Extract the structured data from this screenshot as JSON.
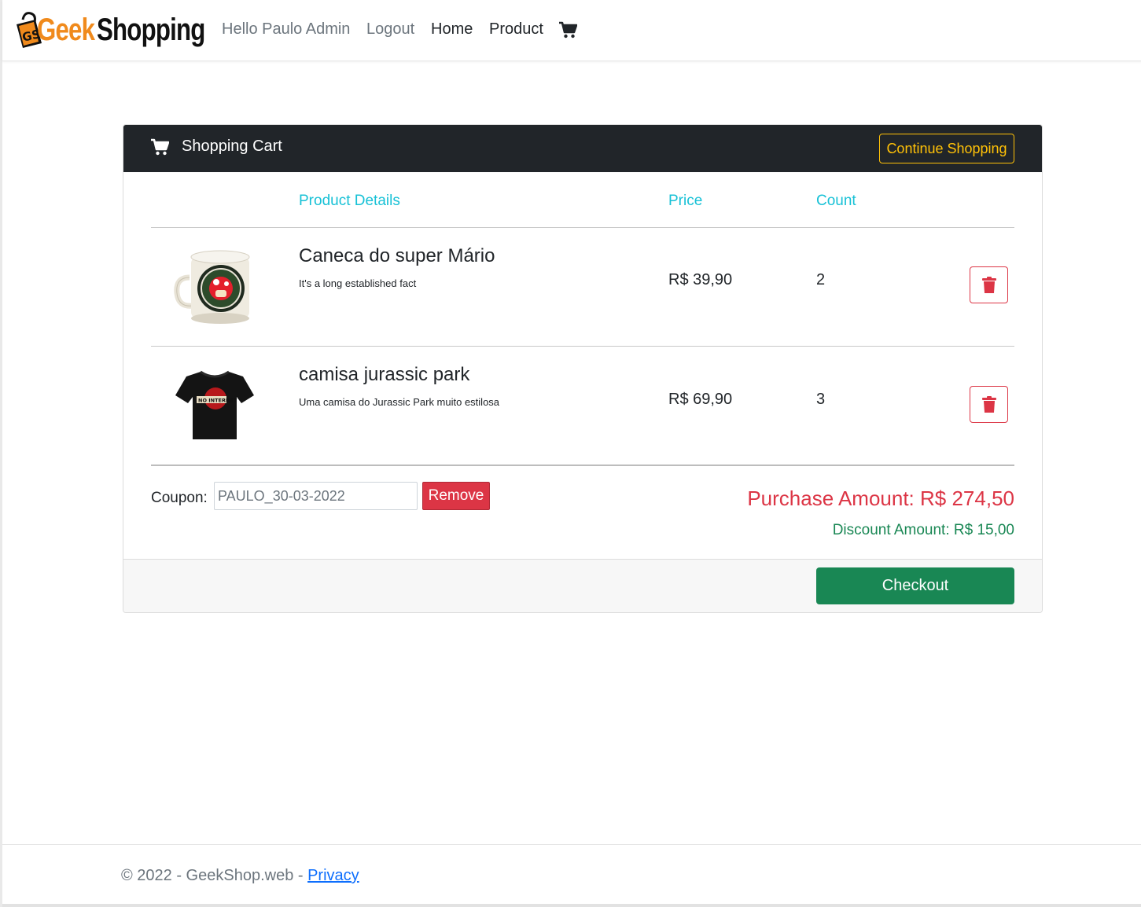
{
  "brand": {
    "geek": "Geek",
    "shopping": "Shopping",
    "logo_icon": "shopping-bag-gs-logo"
  },
  "nav": {
    "greeting": "Hello Paulo Admin",
    "logout": "Logout",
    "home": "Home",
    "product": "Product",
    "cart_icon": "cart-icon"
  },
  "cart": {
    "title": "Shopping Cart",
    "continue_label": "Continue Shopping",
    "columns": {
      "details": "Product Details",
      "price": "Price",
      "count": "Count"
    },
    "items": [
      {
        "name": "Caneca do super Mário",
        "description": "It's a long established fact",
        "price": "R$ 39,90",
        "count": "2",
        "image": "super-mario-mug"
      },
      {
        "name": "camisa jurassic park",
        "description": "Uma camisa do Jurassic Park muito estilosa",
        "price": "R$ 69,90",
        "count": "3",
        "image": "jurassic-park-tshirt"
      }
    ],
    "coupon_label": "Coupon:",
    "coupon_value": "PAULO_30-03-2022",
    "remove_label": "Remove",
    "purchase_amount": "Purchase Amount: R$ 274,50",
    "discount_amount": "Discount Amount: R$ 15,00",
    "checkout_label": "Checkout"
  },
  "footer": {
    "copyright": "© 2022 - GeekShop.web - ",
    "privacy": "Privacy"
  },
  "colors": {
    "header_bg": "#212529",
    "accent_cyan": "#17c1d6",
    "warning": "#ffc107",
    "danger": "#dc3545",
    "success": "#198754",
    "brand_orange": "#f08a1c"
  }
}
